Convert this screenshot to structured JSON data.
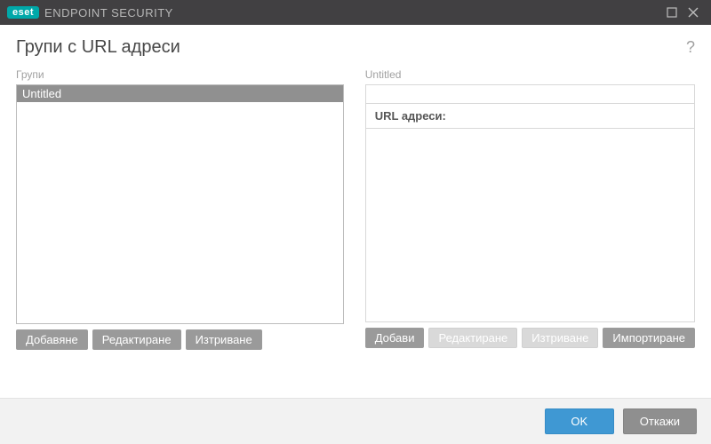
{
  "titlebar": {
    "brand": "eset",
    "product": "ENDPOINT SECURITY"
  },
  "page_title": "Групи с URL адреси",
  "left": {
    "label": "Групи",
    "items": [
      "Untitled"
    ],
    "buttons": {
      "add": "Добавяне",
      "edit": "Редактиране",
      "delete": "Изтриване"
    }
  },
  "right": {
    "label": "Untitled",
    "url_header": "URL адреси:",
    "buttons": {
      "add": "Добави",
      "edit": "Редактиране",
      "delete": "Изтриване",
      "import": "Импортиране"
    }
  },
  "footer": {
    "ok": "OK",
    "cancel": "Откажи"
  }
}
